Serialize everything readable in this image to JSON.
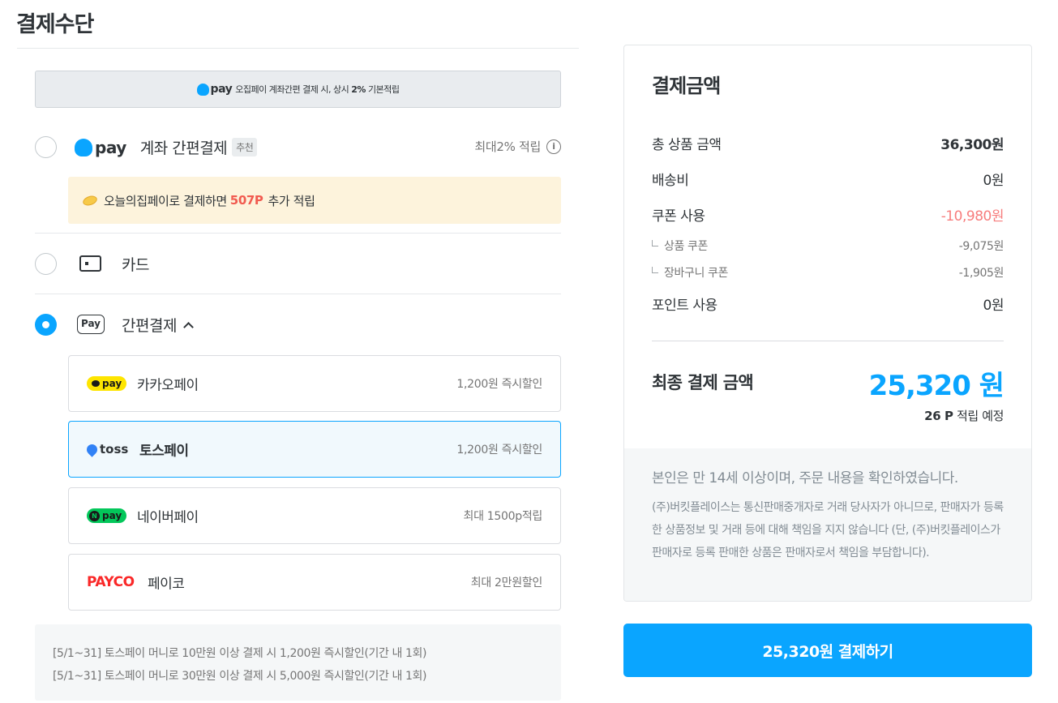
{
  "page": {
    "title": "결제수단"
  },
  "banner": {
    "logo_text": "pay",
    "text_before": "오집페이 계좌간편 결제 시, 상시",
    "highlight": "2%",
    "text_after": "기본적립"
  },
  "options": {
    "account": {
      "logo_text": "pay",
      "label": "계좌 간편결제",
      "tag": "추천",
      "note": "최대2% 적립",
      "promo": {
        "before": "오늘의집페이로 결제하면",
        "highlight": "507P",
        "after": "추가 적립"
      }
    },
    "card": {
      "label": "카드"
    },
    "easy": {
      "icon_text": "Pay",
      "label": "간편결제"
    }
  },
  "easy_pay": [
    {
      "logo": "pay",
      "name": "카카오페이",
      "benefit": "1,200원 즉시할인"
    },
    {
      "logo": "toss",
      "name": "토스페이",
      "benefit": "1,200원 즉시할인"
    },
    {
      "logo": "pay",
      "name": "네이버페이",
      "benefit": "최대 1500p적립"
    },
    {
      "logo": "PAYCO",
      "name": "페이코",
      "benefit": "최대 2만원할인"
    }
  ],
  "notice": [
    "[5/1~31] 토스페이 머니로 10만원 이상 결제 시 1,200원 즉시할인(기간 내 1회)",
    "[5/1~31] 토스페이 머니로 30만원 이상 결제 시 5,000원 즉시할인(기간 내 1회)"
  ],
  "summary": {
    "title": "결제금액",
    "rows": {
      "product": {
        "label": "총 상품 금액",
        "amount": "36,300원"
      },
      "shipping": {
        "label": "배송비",
        "amount": "0원"
      },
      "coupon": {
        "label": "쿠폰 사용",
        "amount": "-10,980원"
      },
      "product_coupon": {
        "label": "상품 쿠폰",
        "amount": "-9,075원"
      },
      "cart_coupon": {
        "label": "장바구니 쿠폰",
        "amount": "-1,905원"
      },
      "points": {
        "label": "포인트 사용",
        "amount": "0원"
      }
    },
    "final_label": "최종 결제 금액",
    "final_amount": "25,320 원",
    "point_value": "26 P",
    "point_suffix": "적립 예정",
    "agree_title": "본인은 만 14세 이상이며, 주문 내용을 확인하였습니다.",
    "agree_desc": "(주)버킷플레이스는 통신판매중개자로 거래 당사자가 아니므로, 판매자가 등록한 상품정보 및 거래 등에 대해 책임을 지지 않습니다 (단, (주)버킷플레이스가 판매자로 등록 판매한 상품은 판매자로서 책임을 부담합니다)."
  },
  "pay_button": "25,320원 결제하기",
  "colors": {
    "accent": "#0aa5ff",
    "discount": "#f77d7d",
    "promo_highlight": "#f15b50",
    "payco": "#fa2828",
    "kakao": "#fee500",
    "naver": "#03c75a"
  }
}
